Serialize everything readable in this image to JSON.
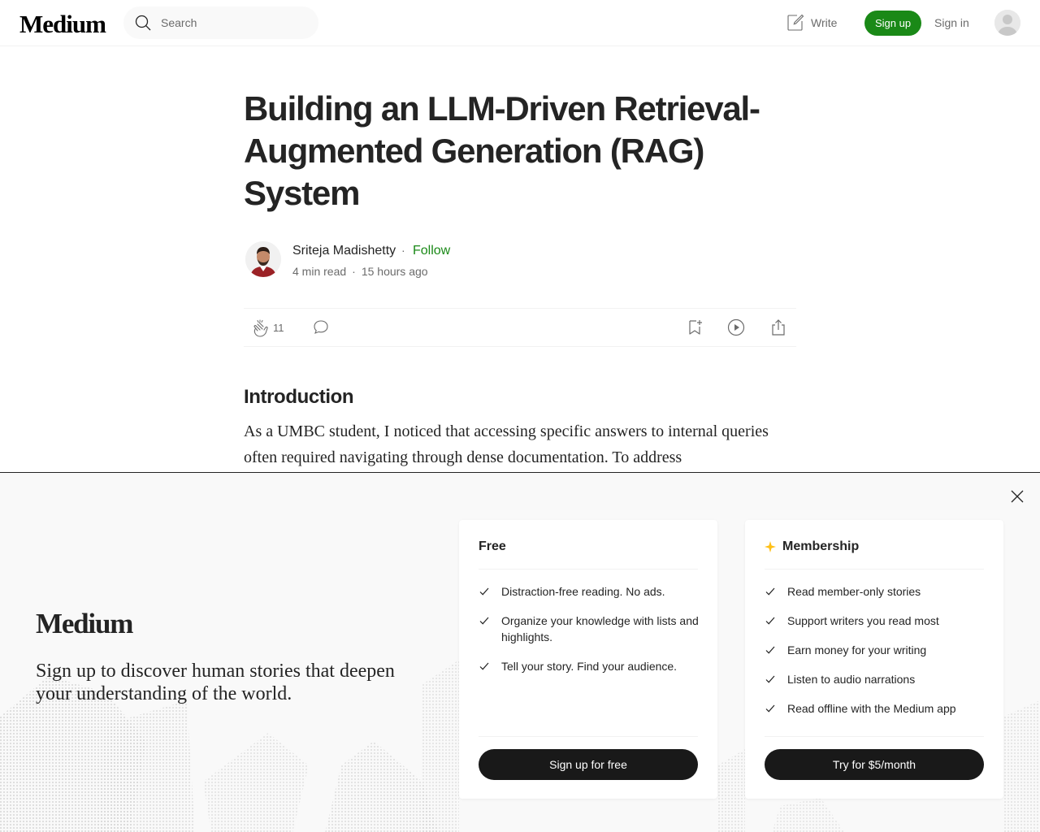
{
  "header": {
    "logo": "Medium",
    "search_placeholder": "Search",
    "write_label": "Write",
    "signup_label": "Sign up",
    "signin_label": "Sign in"
  },
  "article": {
    "title": "Building an LLM-Driven Retrieval-Augmented Generation (RAG) System",
    "author": "Sriteja Madishetty",
    "follow_separator": "·",
    "follow_label": "Follow",
    "read_time": "4 min read",
    "meta_separator": "·",
    "published": "15 hours ago",
    "clap_count": "11",
    "section_heading": "Introduction",
    "paragraph": "As a UMBC student, I noticed that accessing specific answers to internal queries often required navigating through dense documentation. To address"
  },
  "modal": {
    "logo": "Medium",
    "tagline": "Sign up to discover human stories that deepen your understanding of the world.",
    "free": {
      "title": "Free",
      "features": [
        "Distraction-free reading. No ads.",
        "Organize your knowledge with lists and highlights.",
        "Tell your story. Find your audience."
      ],
      "button": "Sign up for free"
    },
    "membership": {
      "title": "Membership",
      "features": [
        "Read member-only stories",
        "Support writers you read most",
        "Earn money for your writing",
        "Listen to audio narrations",
        "Read offline with the Medium app"
      ],
      "button": "Try for $5/month"
    }
  },
  "colors": {
    "brand_green": "#1a8917",
    "text": "#242424",
    "muted": "#6b6b6b",
    "button_dark": "#191919",
    "star": "#ffc017"
  }
}
